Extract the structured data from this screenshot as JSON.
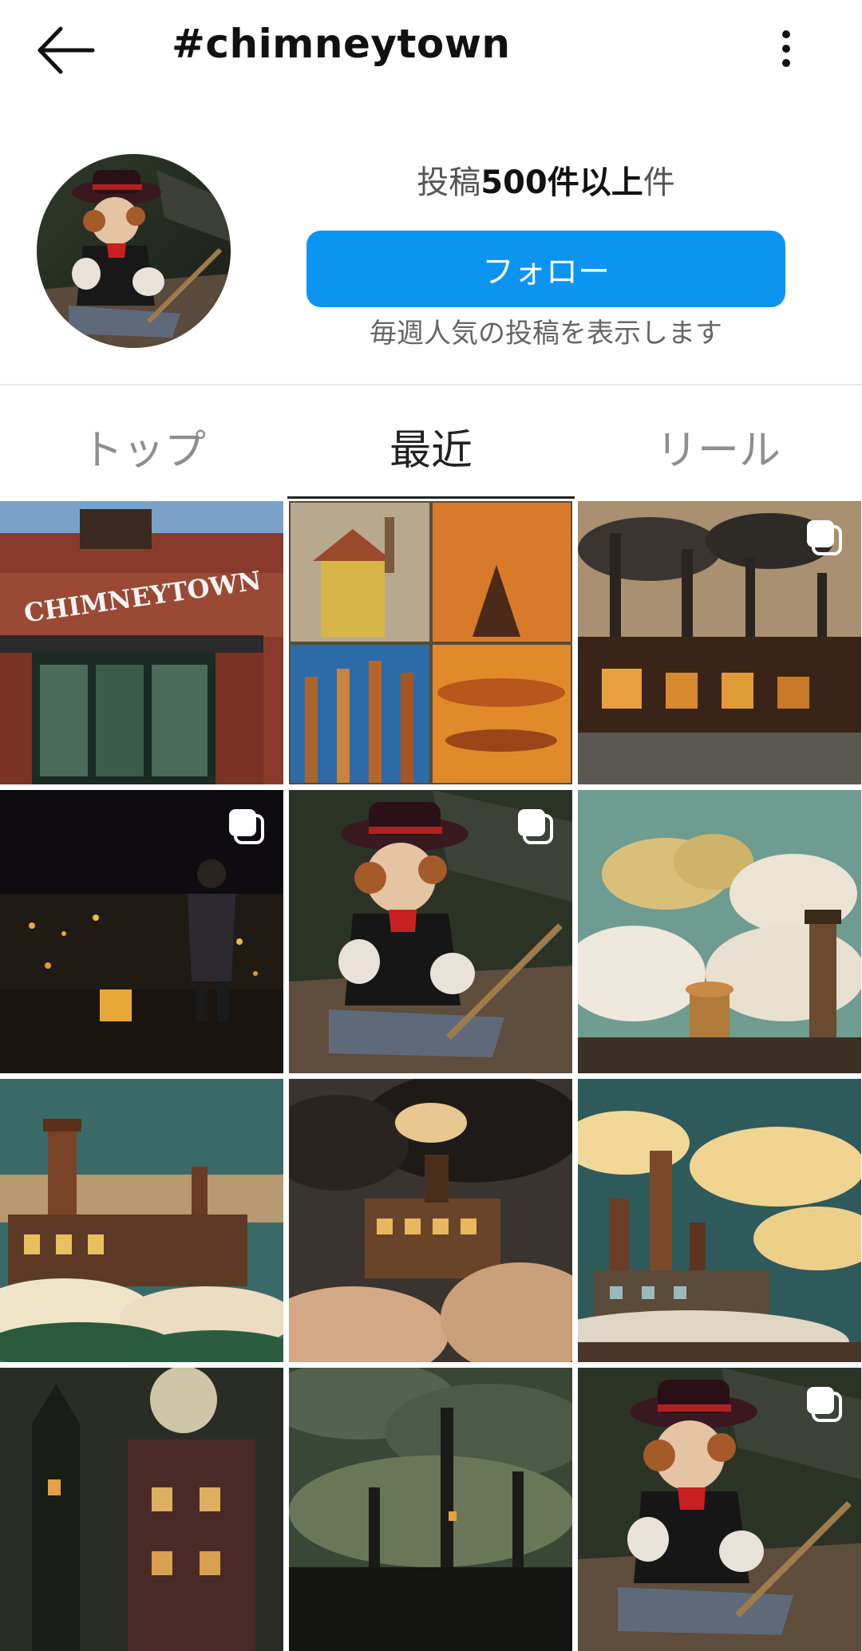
{
  "header": {
    "title": "#chimneytown",
    "back_icon": "back-arrow-icon",
    "more_icon": "more-vertical-icon"
  },
  "profile": {
    "posts_prefix": "投稿",
    "posts_count": "500件以上",
    "posts_suffix": "件",
    "follow_label": "フォロー",
    "weekly_text": "毎週人気の投稿を表示します"
  },
  "tabs": [
    {
      "label": "トップ",
      "active": false
    },
    {
      "label": "最近",
      "active": true
    },
    {
      "label": "リール",
      "active": false
    }
  ],
  "sign_text": "CHIMNEYTOWN",
  "colors": {
    "accent": "#0b95f0",
    "tab_active": "#222222",
    "tab_inactive": "#8e8e8e"
  },
  "grid_items": [
    {
      "name": "storefront-photo",
      "multi": false
    },
    {
      "name": "collage-photo",
      "multi": false
    },
    {
      "name": "industrial-street-photo",
      "multi": true
    },
    {
      "name": "night-city-boy-photo",
      "multi": true
    },
    {
      "name": "boy-portrait-photo",
      "multi": true
    },
    {
      "name": "smoke-towers-photo",
      "multi": false
    },
    {
      "name": "sky-town-photo",
      "multi": false
    },
    {
      "name": "flying-house-photo",
      "multi": false
    },
    {
      "name": "chimney-factory-photo",
      "multi": false
    },
    {
      "name": "moon-castle-photo",
      "multi": false
    },
    {
      "name": "dark-factory-photo",
      "multi": false
    },
    {
      "name": "boy-portrait-photo-2",
      "multi": true
    }
  ]
}
